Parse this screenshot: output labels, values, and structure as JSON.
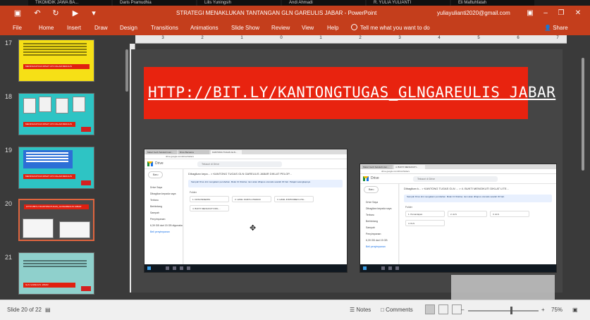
{
  "participants": [
    "TIKOMDIK JAWA BA...",
    "Daris Pramudhia",
    "Lilis Yuningsih",
    "Andi Ahmadi",
    "R. YULIA YULIANTI",
    "Eli Maftuhfatah"
  ],
  "window": {
    "title": "STRATEGI MENAKLUKAN TANTANGAN GLN GAREULIS JABAR  -  PowerPoint",
    "user_email": "yuliayulianti2020@gmail.com",
    "icons": {
      "save": "save-icon",
      "undo": "undo-icon",
      "redo": "redo-icon",
      "start": "present-icon",
      "customize": "customize-qat-icon"
    }
  },
  "ribbon": {
    "tabs": [
      "File",
      "Home",
      "Insert",
      "Draw",
      "Design",
      "Transitions",
      "Animations",
      "Slide Show",
      "Review",
      "View",
      "Help"
    ],
    "tell_me": "Tell me what you want to do",
    "share": "Share"
  },
  "thumbnails": [
    {
      "number": "17",
      "bar_text": "MENINGKATKAN MINAT GTK DALAM MENULIS",
      "bg": "#f6e016"
    },
    {
      "number": "18",
      "bar_text": "MENINGKATKAN MINAT GTK DALAM MENULIS",
      "bg": "#2ec4c4"
    },
    {
      "number": "19",
      "bar_text": "MENINGKATKAN MINAT GTK DALAM MENULIS",
      "bg": "#2ec4c4"
    },
    {
      "number": "20",
      "bar_text": "HTTP://BIT.LY/KANTONGTUGAS_GLNGAREULIS JABAR",
      "bg": "#4a4a4a"
    },
    {
      "number": "21",
      "bar_text": "GLN GAREULIS JABAR",
      "bg": "#8fd0cc"
    }
  ],
  "ruler": [
    "3",
    "2",
    "1",
    "0",
    "1",
    "2",
    "3",
    "4",
    "5",
    "6",
    "7"
  ],
  "slide": {
    "link": "HTTP://BIT.LY/KANTONGTUGAS_GLNGAREULIS JABAR",
    "shot_a": {
      "tabs": [
        "Materi Gerb Sekolah Liter...",
        "Drive Bersama",
        "KANTONG TUGAS GLN..."
      ],
      "url": "drive.google.com/drive/folders",
      "app": "Drive",
      "search": "Telusuri di Drive",
      "sidebar": [
        "Baru",
        "Drive Saya",
        "Dibagikan kepada saya",
        "Terbaru",
        "Berbintang",
        "Sampah",
        "Penyimpanan",
        "6,39 GB dari 15 GB digunakan",
        "Beli penyimpanan"
      ],
      "crumb": "Dibagikan kepa...   >   KANTONG TUGAS GLN GAREULIS JABAR DIKLAT PELOP...",
      "notice": "Sampah Drive kini mengalami perubahan. Mulai 13 Oktober, item akan dihapus otomatis setelah 30 hari. Pelajari selengkapnya",
      "label": "Folder",
      "folders": [
        "1. DATA PESERTA",
        "2. HASIL KARYA LITERASI",
        "3. HASIL INSTRUMEN LITE...",
        "4. BUKTI MENGIKUTI DIKL..."
      ]
    },
    "shot_b": {
      "tabs": [
        "Materi Gerb Sekolah Liter...",
        "4. BUKTI MENGIKUTI..."
      ],
      "url": "drive.google.com/drive/folders",
      "app": "Drive",
      "search": "Telusuri di Drive",
      "sidebar": [
        "Baru",
        "Drive Saya",
        "Dibagikan kepada saya",
        "Terbaru",
        "Berbintang",
        "Sampah",
        "Penyimpanan",
        "6,39 GB dari 15 GB",
        "Beli penyimpanan"
      ],
      "crumb": "Dibagikan k...  >  KANTONG TUGAS GLN ...  >  4. BUKTI MENGIKUTI DIKLAT LITE...",
      "notice": "Sampah Drive kini mengalami perubahan. Mulai 13 Oktober, item akan dihapus otomatis setelah 30 hari.",
      "label": "Folder",
      "folders": [
        "1. Pemantapan",
        "2. ALS",
        "3. ALS",
        "4. KLS"
      ]
    }
  },
  "status": {
    "slide_of": "Slide 20 of 22",
    "notes": "Notes",
    "comments": "Comments",
    "zoom": "75%"
  },
  "colors": {
    "accent": "#c43e1c",
    "banner": "#e8230f"
  }
}
